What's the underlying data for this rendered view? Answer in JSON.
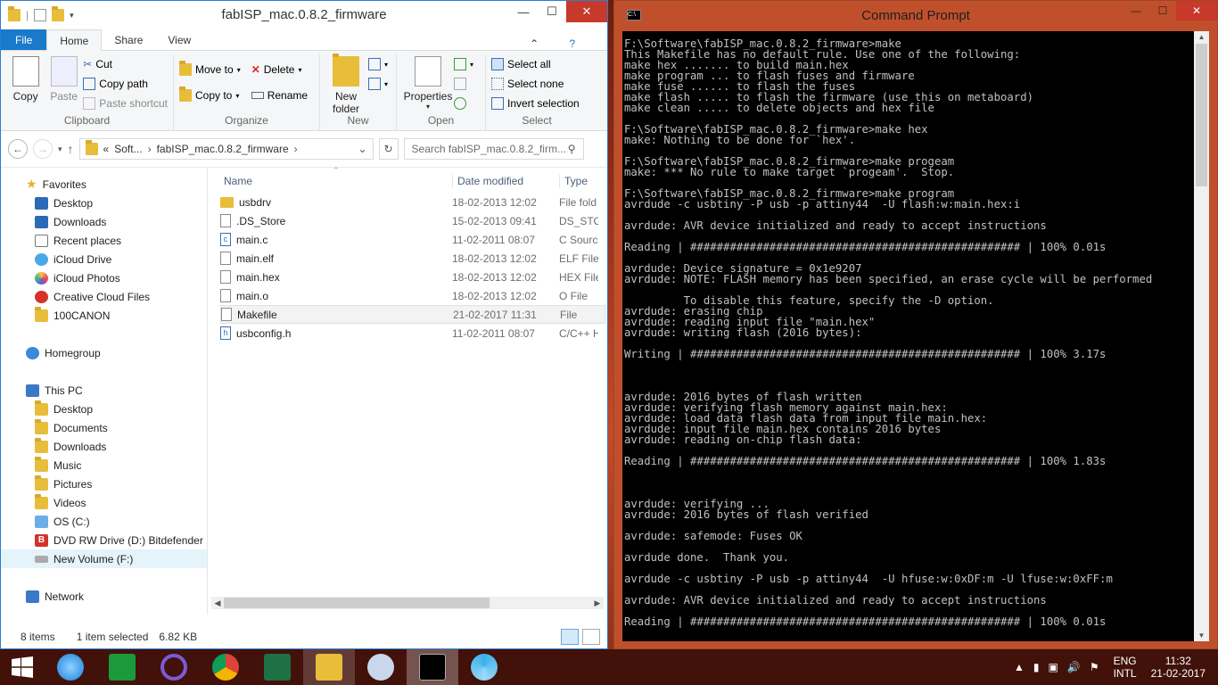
{
  "explorer": {
    "title": "fabISP_mac.0.8.2_firmware",
    "tabs": [
      {
        "label": "File"
      },
      {
        "label": "Home"
      },
      {
        "label": "Share"
      },
      {
        "label": "View"
      }
    ],
    "ribbon": {
      "clipboard": {
        "copy": "Copy",
        "paste": "Paste",
        "cut": "Cut",
        "copy_path": "Copy path",
        "paste_shortcut": "Paste shortcut",
        "label": "Clipboard"
      },
      "organize": {
        "move_to": "Move to",
        "copy_to": "Copy to",
        "delete": "Delete",
        "rename": "Rename",
        "label": "Organize"
      },
      "new": {
        "new_folder_1": "New",
        "new_folder_2": "folder",
        "label": "New"
      },
      "open": {
        "properties": "Properties",
        "label": "Open"
      },
      "select": {
        "select_all": "Select all",
        "select_none": "Select none",
        "invert": "Invert selection",
        "label": "Select"
      }
    },
    "address": {
      "prefix": "«",
      "crumbs": [
        "Soft...",
        "fabISP_mac.0.8.2_firmware"
      ],
      "sep": "›",
      "search_placeholder": "Search fabISP_mac.0.8.2_firm..."
    },
    "nav": {
      "favorites": "Favorites",
      "fav_items": [
        "Desktop",
        "Downloads",
        "Recent places",
        "iCloud Drive",
        "iCloud Photos",
        "Creative Cloud Files",
        "100CANON"
      ],
      "homegroup": "Homegroup",
      "thispc": "This PC",
      "pc_items": [
        "Desktop",
        "Documents",
        "Downloads",
        "Music",
        "Pictures",
        "Videos",
        "OS (C:)",
        "DVD RW Drive (D:) Bitdefender",
        "New Volume (F:)"
      ],
      "network": "Network"
    },
    "columns": {
      "name": "Name",
      "date": "Date modified",
      "type": "Type"
    },
    "files": [
      {
        "name": "usbdrv",
        "date": "18-02-2013 12:02",
        "type": "File fold"
      },
      {
        "name": ".DS_Store",
        "date": "15-02-2013 09:41",
        "type": "DS_STOR"
      },
      {
        "name": "main.c",
        "date": "11-02-2011 08:07",
        "type": "C Source"
      },
      {
        "name": "main.elf",
        "date": "18-02-2013 12:02",
        "type": "ELF File"
      },
      {
        "name": "main.hex",
        "date": "18-02-2013 12:02",
        "type": "HEX File"
      },
      {
        "name": "main.o",
        "date": "18-02-2013 12:02",
        "type": "O File"
      },
      {
        "name": "Makefile",
        "date": "21-02-2017 11:31",
        "type": "File"
      },
      {
        "name": "usbconfig.h",
        "date": "11-02-2011 08:07",
        "type": "C/C++ H"
      }
    ],
    "status": {
      "count": "8 items",
      "selected": "1 item selected",
      "size": "6.82 KB"
    }
  },
  "cmd": {
    "title": "Command Prompt",
    "lines": [
      "F:\\Software\\fabISP_mac.0.8.2_firmware>make",
      "This Makefile has no default rule. Use one of the following:",
      "make hex ....... to build main.hex",
      "make program ... to flash fuses and firmware",
      "make fuse ...... to flash the fuses",
      "make flash ..... to flash the firmware (use this on metaboard)",
      "make clean ..... to delete objects and hex file",
      "",
      "F:\\Software\\fabISP_mac.0.8.2_firmware>make hex",
      "make: Nothing to be done for `hex'.",
      "",
      "F:\\Software\\fabISP_mac.0.8.2_firmware>make progeam",
      "make: *** No rule to make target `progeam'.  Stop.",
      "",
      "F:\\Software\\fabISP_mac.0.8.2_firmware>make program",
      "avrdude -c usbtiny -P usb -p attiny44  -U flash:w:main.hex:i",
      "",
      "avrdude: AVR device initialized and ready to accept instructions",
      "",
      "Reading | ################################################## | 100% 0.01s",
      "",
      "avrdude: Device signature = 0x1e9207",
      "avrdude: NOTE: FLASH memory has been specified, an erase cycle will be performed",
      "",
      "         To disable this feature, specify the -D option.",
      "avrdude: erasing chip",
      "avrdude: reading input file \"main.hex\"",
      "avrdude: writing flash (2016 bytes):",
      "",
      "Writing | ################################################## | 100% 3.17s",
      "",
      "",
      "",
      "avrdude: 2016 bytes of flash written",
      "avrdude: verifying flash memory against main.hex:",
      "avrdude: load data flash data from input file main.hex:",
      "avrdude: input file main.hex contains 2016 bytes",
      "avrdude: reading on-chip flash data:",
      "",
      "Reading | ################################################## | 100% 1.83s",
      "",
      "",
      "",
      "avrdude: verifying ...",
      "avrdude: 2016 bytes of flash verified",
      "",
      "avrdude: safemode: Fuses OK",
      "",
      "avrdude done.  Thank you.",
      "",
      "avrdude -c usbtiny -P usb -p attiny44  -U hfuse:w:0xDF:m -U lfuse:w:0xFF:m",
      "",
      "avrdude: AVR device initialized and ready to accept instructions",
      "",
      "Reading | ################################################## | 100% 0.01s"
    ]
  },
  "taskbar": {
    "apps": [
      "start-button",
      "internet-explorer",
      "store",
      "visual-studio",
      "chrome",
      "excel",
      "file-explorer",
      "paint",
      "command-prompt",
      "app"
    ],
    "lang_1": "ENG",
    "lang_2": "INTL",
    "time": "11:32",
    "date": "21-02-2017"
  },
  "colors": {
    "accent": "#1979ca",
    "close": "#c7392a",
    "console_bg": "#000000",
    "console_fg": "#c0c0c0"
  }
}
